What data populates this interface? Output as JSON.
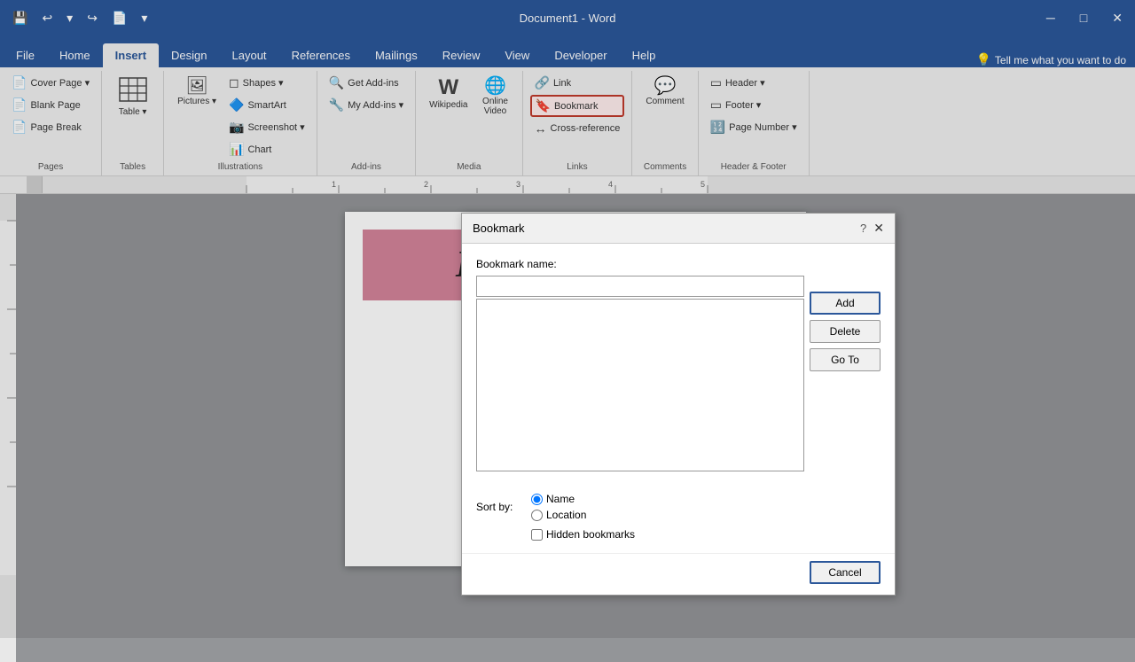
{
  "titlebar": {
    "title": "Document1 - Word",
    "save_label": "💾",
    "undo_label": "↩",
    "redo_label": "↪",
    "new_label": "📄",
    "autosave_label": "⏷"
  },
  "tabs": [
    {
      "label": "File",
      "active": false
    },
    {
      "label": "Home",
      "active": false
    },
    {
      "label": "Insert",
      "active": true
    },
    {
      "label": "Design",
      "active": false
    },
    {
      "label": "Layout",
      "active": false
    },
    {
      "label": "References",
      "active": false
    },
    {
      "label": "Mailings",
      "active": false
    },
    {
      "label": "Review",
      "active": false
    },
    {
      "label": "View",
      "active": false
    },
    {
      "label": "Developer",
      "active": false
    },
    {
      "label": "Help",
      "active": false
    }
  ],
  "ribbon": {
    "groups": {
      "pages": {
        "label": "Pages",
        "items": [
          {
            "label": "Cover Page",
            "icon": "📄"
          },
          {
            "label": "Blank Page",
            "icon": "📄"
          },
          {
            "label": "Page Break",
            "icon": "📄"
          }
        ]
      },
      "tables": {
        "label": "Tables",
        "item": {
          "label": "Table",
          "icon": "⊞"
        }
      },
      "illustrations": {
        "label": "Illustrations",
        "items": [
          {
            "label": "Pictures",
            "icon": "🖼"
          },
          {
            "label": "Shapes",
            "icon": "◻"
          },
          {
            "label": "SmartArt",
            "icon": "📊"
          },
          {
            "label": "Screenshot",
            "icon": "📷"
          },
          {
            "label": "Chart",
            "icon": "📈"
          }
        ]
      },
      "addins": {
        "label": "Add-ins",
        "items": [
          {
            "label": "Get Add-ins",
            "icon": "🔍"
          },
          {
            "label": "My Add-ins",
            "icon": "🔧"
          }
        ]
      },
      "media": {
        "label": "Media",
        "items": [
          {
            "label": "Wikipedia",
            "icon": "W"
          },
          {
            "label": "Online Video",
            "icon": "▶"
          }
        ]
      },
      "links": {
        "label": "Links",
        "items": [
          {
            "label": "Link",
            "icon": "🔗"
          },
          {
            "label": "Bookmark",
            "icon": "🔖"
          },
          {
            "label": "Cross-reference",
            "icon": "↔"
          }
        ]
      },
      "comments": {
        "label": "Comments",
        "item": {
          "label": "Comment",
          "icon": "💬"
        }
      },
      "header_footer": {
        "label": "Header & Footer",
        "items": [
          {
            "label": "Header",
            "icon": "▭"
          },
          {
            "label": "Footer",
            "icon": "▭"
          },
          {
            "label": "Page Number",
            "icon": "🔢"
          }
        ]
      }
    }
  },
  "tellme": {
    "placeholder": "Tell me what you want to do",
    "icon": "💡"
  },
  "document": {
    "banner_text": "BOOKMARK",
    "banner_bg": "#d4849a"
  },
  "dialog": {
    "title": "Bookmark",
    "label": "Bookmark name:",
    "input_placeholder": "",
    "sort_by_label": "Sort by:",
    "sort_options": [
      {
        "label": "Name",
        "checked": true
      },
      {
        "label": "Location",
        "checked": false
      }
    ],
    "hidden_bookmarks_label": "Hidden bookmarks",
    "hidden_bookmarks_checked": false,
    "buttons": {
      "add": "Add",
      "delete": "Delete",
      "goto": "Go To",
      "cancel": "Cancel"
    }
  }
}
